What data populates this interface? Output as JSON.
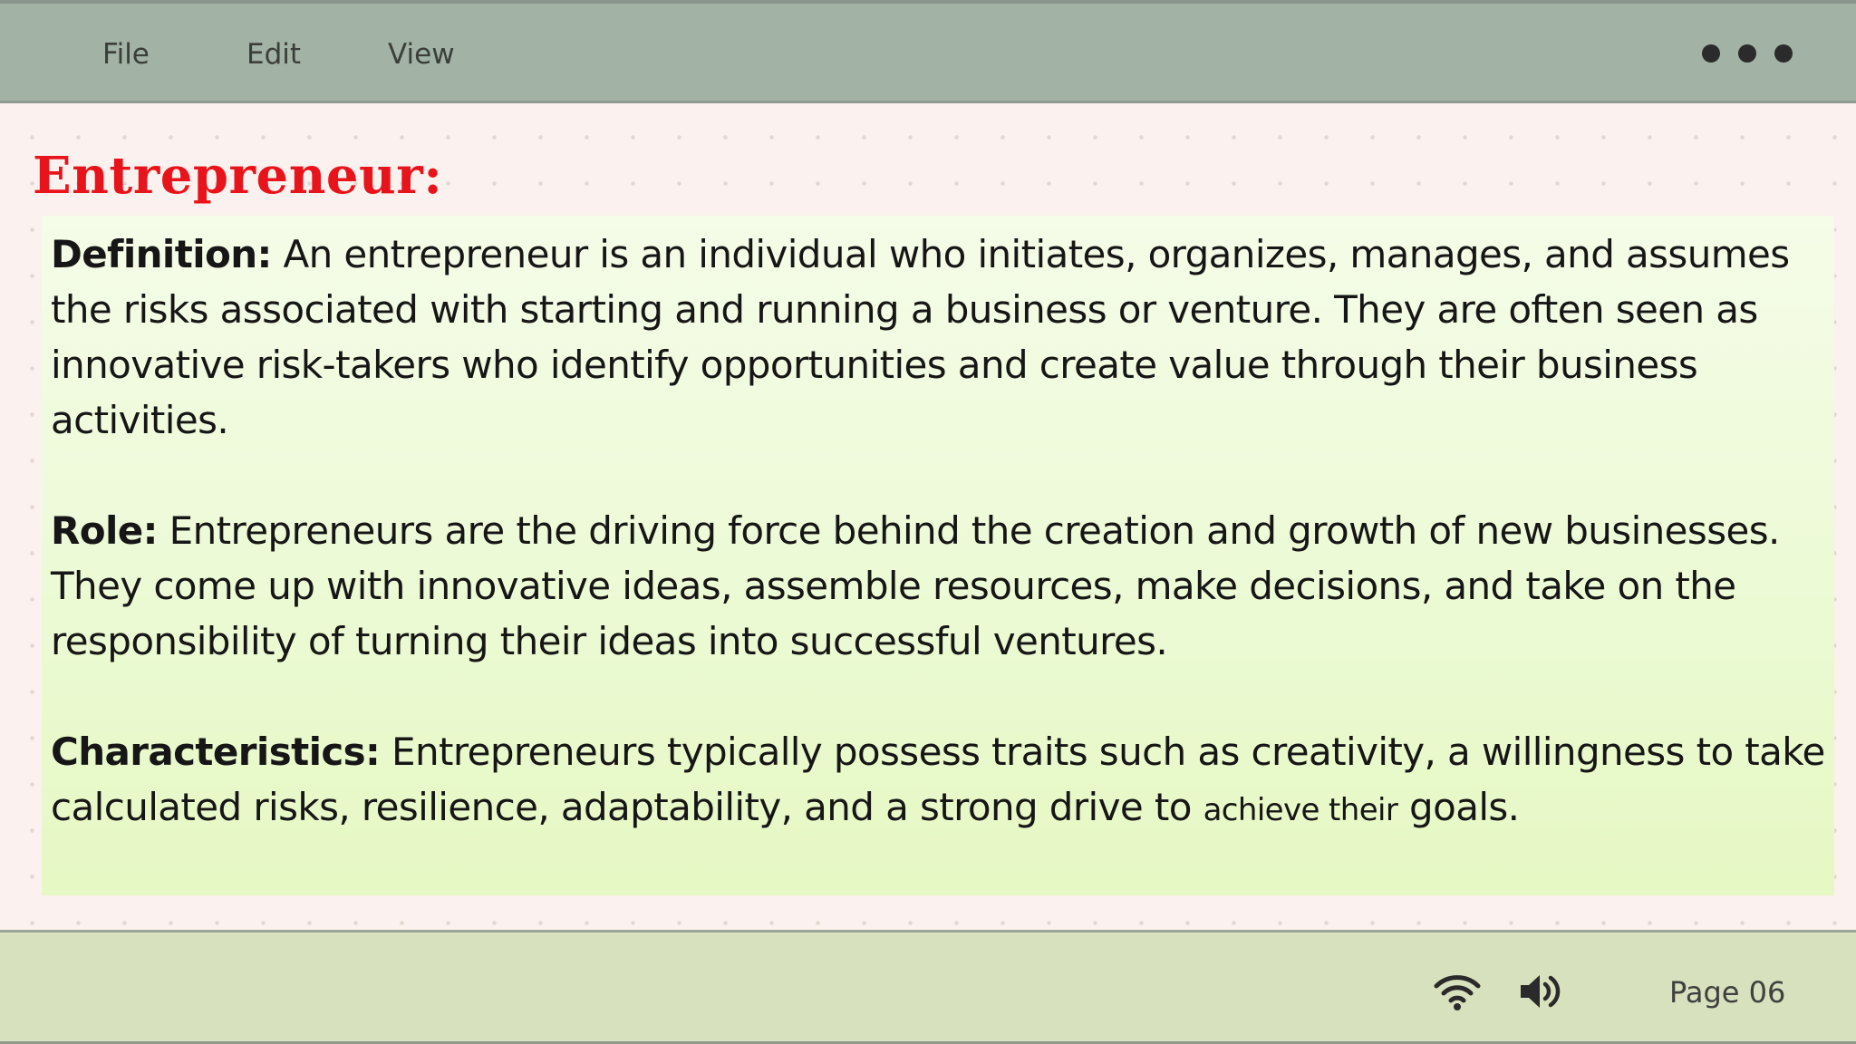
{
  "menubar": {
    "items": [
      {
        "label": "File"
      },
      {
        "label": "Edit"
      },
      {
        "label": "View"
      }
    ],
    "more_icon": "more-horizontal-icon"
  },
  "document": {
    "heading": "Entrepreneur:",
    "sections": [
      {
        "label": "Definition:",
        "text": " An entrepreneur is an individual who initiates, organizes, manages, and assumes the risks associated with starting and running a business or venture. They are often seen as innovative risk-takers who identify opportunities and create value through their business activities."
      },
      {
        "label": "Role:",
        "text": " Entrepreneurs are the driving force behind the creation and growth of new businesses. They come up with innovative ideas, assemble resources, make decisions, and take on the responsibility of turning their ideas into successful ventures."
      },
      {
        "label": "Characteristics:",
        "text_before": " Entrepreneurs typically possess traits such as creativity, a willingness to take calculated risks, resilience, adaptability, and a strong drive to ",
        "text_small": "achieve their",
        "text_after": " goals."
      }
    ]
  },
  "statusbar": {
    "wifi_icon": "wifi-icon",
    "volume_icon": "volume-icon",
    "page_label": "Page 06"
  },
  "colors": {
    "heading": "#e8141b",
    "menubar_bg": "#a2b2a5",
    "statusbar_bg": "#d7e1bd",
    "content_panel_bg": "#ecfad5",
    "canvas_bg": "#fbf1ee"
  }
}
